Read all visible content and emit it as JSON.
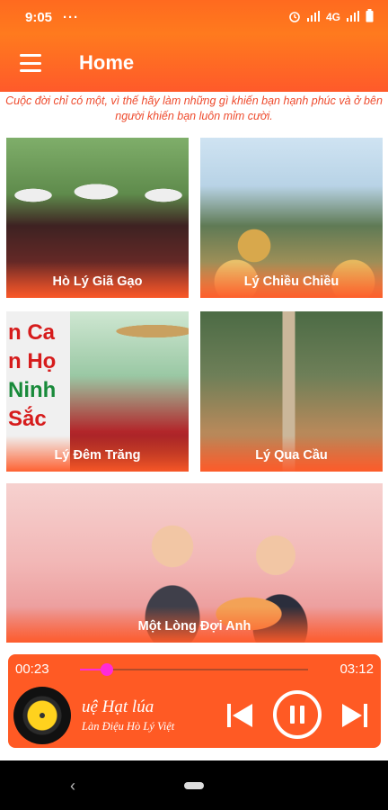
{
  "status_bar": {
    "time": "9:05",
    "dots": "···",
    "network": "4G",
    "icons": [
      "alarm-icon",
      "signal-icon",
      "battery-icon"
    ]
  },
  "app_bar": {
    "title": "Home",
    "menu_icon": "hamburger-menu-icon"
  },
  "quote": "Cuộc đời chỉ có một, vì thế hãy làm những gì khiến bạn hạnh phúc và ở bên người khiến bạn luôn mỉm cười.",
  "songs": [
    {
      "label": "Hò Lý Giã Gạo"
    },
    {
      "label": "Lý Chiều Chiều"
    },
    {
      "label": "Lý Đêm Trăng"
    },
    {
      "label": "Lý Qua Cầu"
    },
    {
      "label": "Một Lòng Đợi Anh"
    }
  ],
  "thumbnail_text": {
    "line1": "n Ca",
    "line2": "n Họ",
    "line3": "Ninh",
    "line4": "Sắc"
  },
  "player": {
    "elapsed": "00:23",
    "total": "03:12",
    "progress": 0.12,
    "song_title": "uệ    Hạt lúa",
    "artist": "Làn Điệu Hò Lý Việt",
    "colors": {
      "accent": "#ff2bd8",
      "background": "#ff5a24"
    },
    "icons": [
      "vinyl-disc-icon",
      "skip-previous-icon",
      "pause-icon",
      "skip-next-icon"
    ]
  },
  "nav_bar": {
    "back_glyph": "‹"
  }
}
